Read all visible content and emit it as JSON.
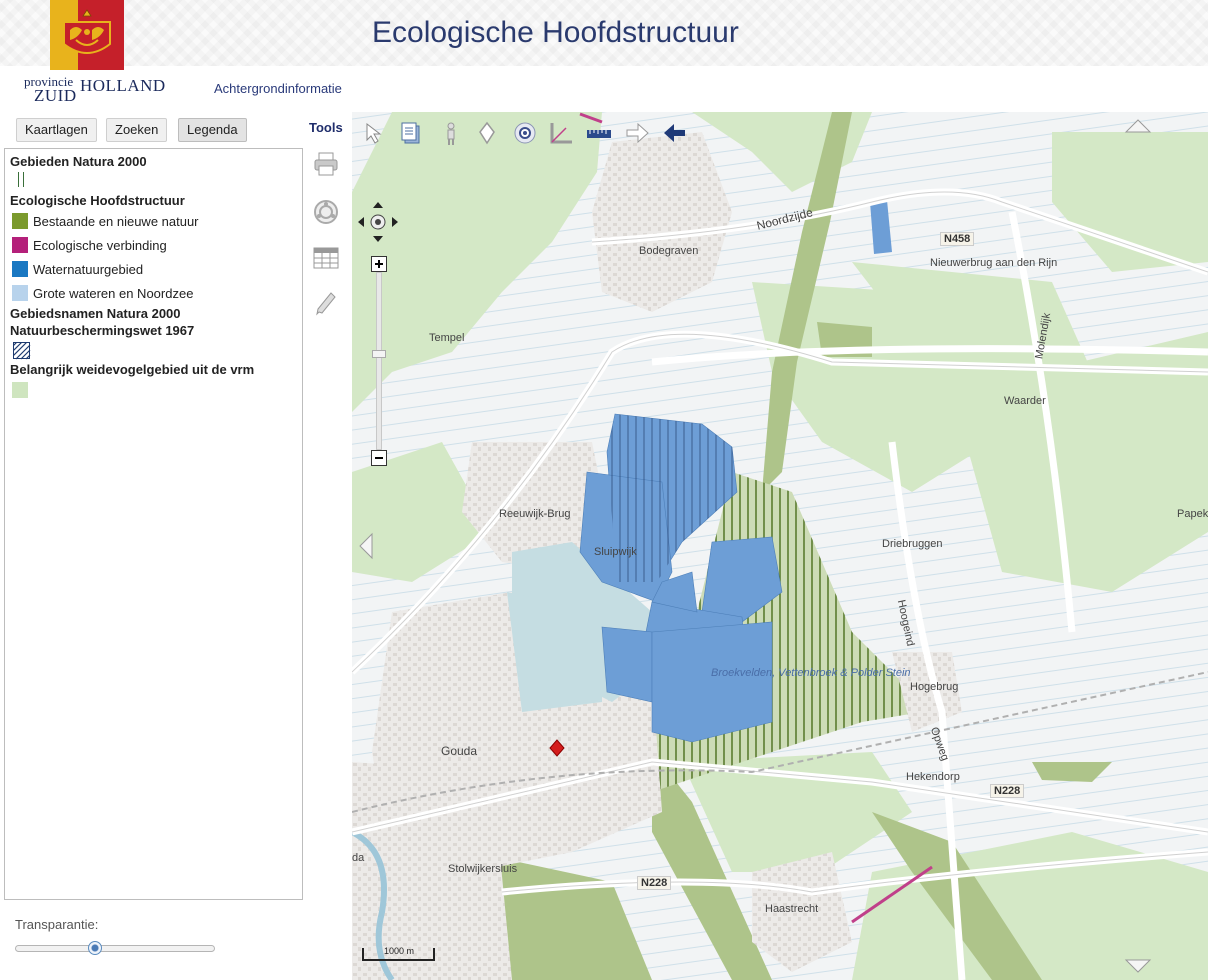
{
  "header": {
    "title": "Ecologische Hoofdstructuur",
    "logo_small": "provincie",
    "logo_zuid": "ZUID",
    "logo_holland": "HOLLAND",
    "nav_link": "Achtergrondinformatie"
  },
  "tabs": [
    {
      "label": "Kaartlagen",
      "active": false
    },
    {
      "label": "Zoeken",
      "active": false
    },
    {
      "label": "Legenda",
      "active": true
    }
  ],
  "legend": {
    "heading_natura": "Gebieden Natura 2000",
    "heading_ehs": "Ecologische Hoofdstructuur",
    "items": [
      {
        "label": "Bestaande en nieuwe natuur",
        "color": "#7b9a2d"
      },
      {
        "label": "Ecologische verbinding",
        "color": "#b4207a"
      },
      {
        "label": "Waternatuurgebied",
        "color": "#1a78c2"
      },
      {
        "label": "Grote wateren en Noordzee",
        "color": "#b8d3ec"
      }
    ],
    "heading_namen_1": "Gebiedsnamen Natura 2000",
    "heading_namen_2": "Natuurbeschermingswet 1967",
    "heading_weide": "Belangrijk weidevogelgebied uit de vrm",
    "weide_color": "#cfe5bf"
  },
  "transparency": {
    "label": "Transparantie:",
    "value": 0.4
  },
  "tools": {
    "label": "Tools",
    "side": [
      "printer-icon",
      "refresh-icon",
      "table-icon",
      "pencil-icon"
    ],
    "top": [
      "select-arrow-icon",
      "document-icon",
      "person-icon",
      "location-pin-icon",
      "eye-icon",
      "angle-measure-icon",
      "ruler-icon",
      "forward-arrow-icon",
      "back-arrow-icon"
    ]
  },
  "map": {
    "places": [
      {
        "name": "Bodegraven"
      },
      {
        "name": "Noordzijde"
      },
      {
        "name": "Nieuwerbrug aan den Rijn"
      },
      {
        "name": "Tempel"
      },
      {
        "name": "Waarder"
      },
      {
        "name": "Reeuwijk-Brug"
      },
      {
        "name": "Sluipwijk"
      },
      {
        "name": "Driebruggen"
      },
      {
        "name": "Papekop"
      },
      {
        "name": "Hoogeind"
      },
      {
        "name": "Broekvelden, Vettenbroek & Polder Stein"
      },
      {
        "name": "Hogebrug"
      },
      {
        "name": "Gouda"
      },
      {
        "name": "Opweg"
      },
      {
        "name": "Hekendorp"
      },
      {
        "name": "Stolwijkersluis"
      },
      {
        "name": "Haastrecht"
      },
      {
        "name": "da"
      },
      {
        "name": "Molendijk"
      }
    ],
    "roads": [
      "N458",
      "N228",
      "N228"
    ],
    "scale": "1000 m"
  }
}
